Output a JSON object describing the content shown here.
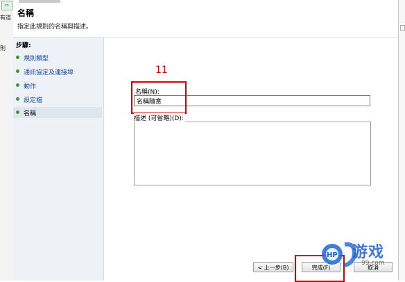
{
  "background": {
    "strip_text_1": "有道",
    "strip_text_2": "則"
  },
  "wizard": {
    "title": "名稱",
    "subtitle": "指定此規則的名稱與描述。",
    "steps_title": "步驟:",
    "steps": [
      {
        "label": "規則類型"
      },
      {
        "label": "通訊協定及連接埠"
      },
      {
        "label": "動作"
      },
      {
        "label": "設定檔"
      },
      {
        "label": "名稱"
      }
    ],
    "name_label": "名稱(N):",
    "name_value": "名稱隨意",
    "description_label": "描述 (可省略)(D):",
    "buttons": {
      "back": "< 上一步(B)",
      "finish": "完成(F)",
      "cancel": "取消"
    }
  },
  "annotation": {
    "step_number": "11",
    "color": "#d80000"
  },
  "watermark": {
    "logo_text": "HP",
    "brand": "游戏",
    "url": "99.com"
  }
}
